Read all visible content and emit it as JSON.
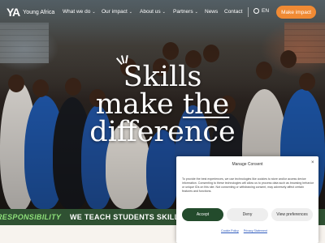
{
  "brand": {
    "mark": "YA",
    "name": "Young Africa"
  },
  "nav": {
    "items": [
      {
        "label": "What we do",
        "chevron": true
      },
      {
        "label": "Our impact",
        "chevron": true
      },
      {
        "label": "About us",
        "chevron": true
      },
      {
        "label": "Partners",
        "chevron": true
      },
      {
        "label": "News",
        "chevron": false
      },
      {
        "label": "Contact",
        "chevron": false
      }
    ],
    "language": "EN",
    "cta": "Make impact"
  },
  "hero": {
    "headline_line1": "Skills",
    "headline_line2_a": "make ",
    "headline_line2_b": "the",
    "headline_line3": "difference"
  },
  "ticker": {
    "part1": "RESPONSIBILITY",
    "part2": "WE TEACH STUDENTS SKILLS OF T"
  },
  "consent": {
    "title": "Manage Consent",
    "close": "×",
    "body": "To provide the best experiences, we use technologies like cookies to store and/or access device information. Consenting to these technologies will allow us to process data such as browsing behavior or unique IDs on this site. Not consenting or withdrawing consent, may adversely affect certain features and functions.",
    "accept": "Accept",
    "deny": "Deny",
    "preferences": "View preferences",
    "cookie_policy": "Cookie Policy",
    "privacy_statement": "Privacy Statement"
  },
  "colors": {
    "accent": "#f08a34",
    "dark_green": "#234b2c",
    "ticker_bg": "#2f5132",
    "ticker_highlight": "#8ee07a"
  }
}
